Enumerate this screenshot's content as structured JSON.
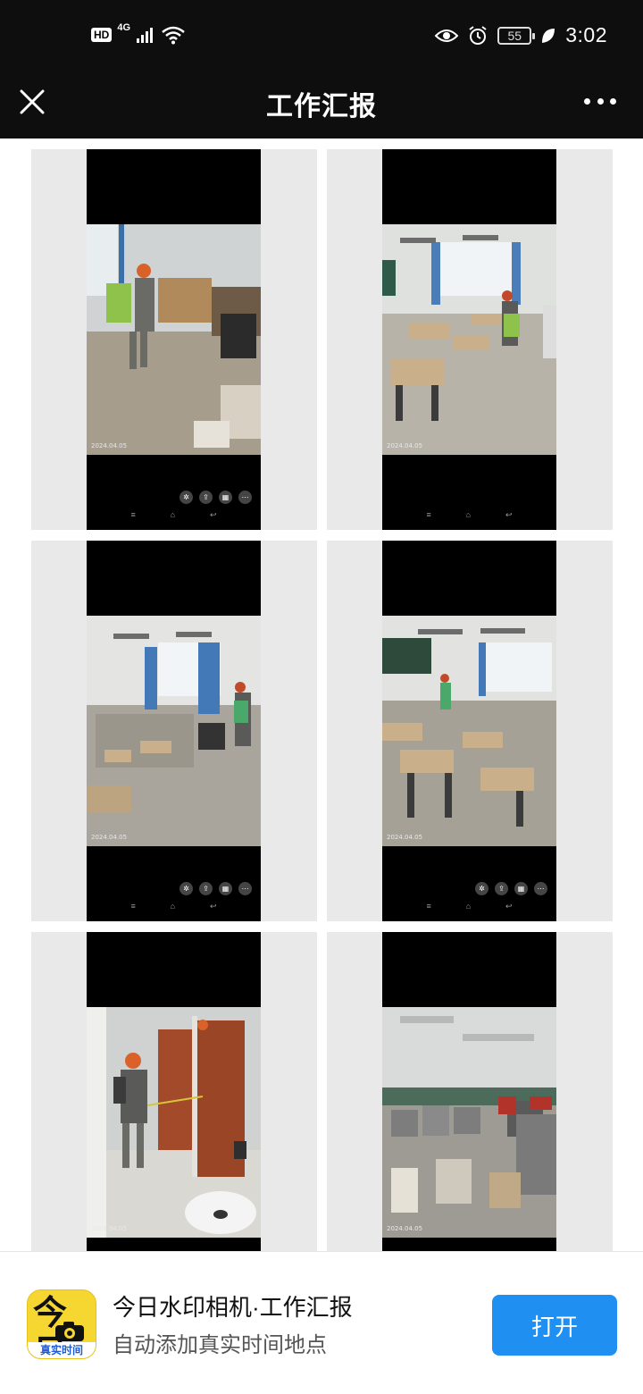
{
  "status_bar": {
    "hd": "HD",
    "network": "4G",
    "battery": "55",
    "time": "3:02",
    "icons": [
      "signal-icon",
      "wifi-icon",
      "eye-icon",
      "alarm-icon",
      "leaf-icon"
    ]
  },
  "nav": {
    "title": "工作汇报",
    "close_icon": "close-icon",
    "more_icon": "more-icon"
  },
  "photos": [
    {
      "date": "2024.04.05",
      "scene": "office-spraying"
    },
    {
      "date": "2024.04.05",
      "scene": "classroom-spraying"
    },
    {
      "date": "2024.04.05",
      "scene": "classroom-spraying"
    },
    {
      "date": "2024.04.05",
      "scene": "classroom-spraying"
    },
    {
      "date": "2024.04.05",
      "scene": "restroom-spraying"
    },
    {
      "date": "2024.04.05",
      "scene": "storage-room"
    }
  ],
  "banner": {
    "logo_top": "今日",
    "logo_bottom": "真实时间",
    "app_name": "今日水印相机·工作汇报",
    "app_desc": "自动添加真实时间地点",
    "open_label": "打开"
  },
  "colors": {
    "top_bar": "#0e0e0e",
    "card_bg": "#e9e9e9",
    "open_button": "#1f8ff2",
    "logo_yellow": "#f6d631"
  }
}
